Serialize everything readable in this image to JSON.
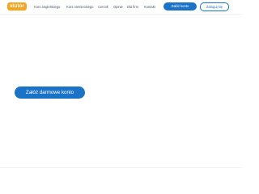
{
  "header": {
    "logo_text": "etutor",
    "logo_color": "#f5a623",
    "nav": [
      {
        "label": "Kurs angielskiego"
      },
      {
        "label": "Kurs niemieckiego"
      },
      {
        "label": "Cennik"
      },
      {
        "label": "Opinie"
      },
      {
        "label": "Dla firm"
      },
      {
        "label": "Kontakt"
      }
    ],
    "signup_label": "Załóż konto",
    "login_label": "Zaloguj się"
  },
  "main": {
    "cta_label": "Załóż darmowe konto"
  },
  "colors": {
    "primary": "#1a73c7",
    "text": "#4a5568",
    "background": "#ffffff"
  }
}
